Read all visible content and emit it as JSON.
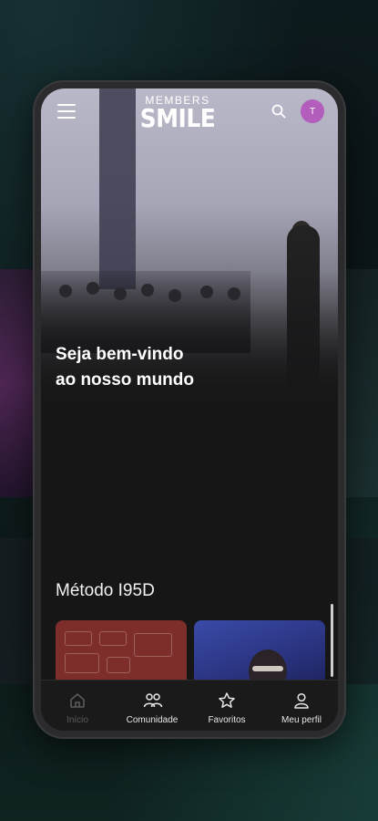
{
  "header": {
    "logo_line1": "MEMBERS",
    "logo_line2": "SMILE",
    "avatar_initial": "T"
  },
  "hero": {
    "welcome_line1": "Seja bem-vindo",
    "welcome_line2": "ao nosso mundo"
  },
  "section": {
    "title": "Método I95D"
  },
  "bottom_nav": [
    {
      "label": "Início",
      "icon": "home-icon",
      "active": true
    },
    {
      "label": "Comunidade",
      "icon": "community-icon",
      "active": false
    },
    {
      "label": "Favoritos",
      "icon": "star-icon",
      "active": false
    },
    {
      "label": "Meu perfil",
      "icon": "profile-icon",
      "active": false
    }
  ],
  "colors": {
    "avatar": "#b35dbd",
    "screen_bg": "#161616",
    "nav_active": "#5a5a5a"
  }
}
